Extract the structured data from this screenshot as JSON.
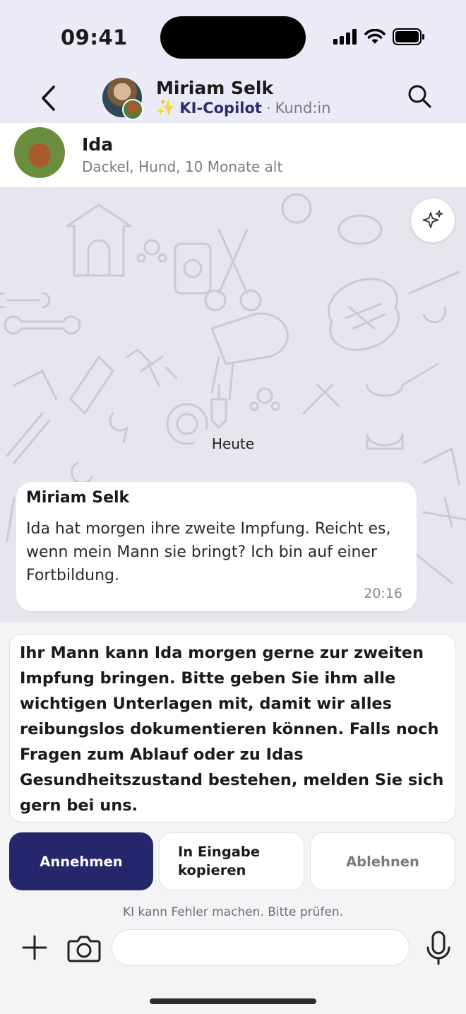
{
  "status_bar": {
    "time": "09:41"
  },
  "header": {
    "name": "Miriam Selk",
    "sparkle": "✨",
    "copilot": "KI-Copilot",
    "separator": "·",
    "role": "Kund:in"
  },
  "contact": {
    "pet_name": "Ida",
    "pet_info": "Dackel, Hund, 10 Monate alt"
  },
  "chat": {
    "day_label": "Heute",
    "message": {
      "sender": "Miriam Selk",
      "text": "Ida hat morgen ihre zweite Impfung. Reicht es, wenn mein Mann sie bringt? Ich bin auf einer Fortbildung.",
      "time": "20:16"
    }
  },
  "suggestion": {
    "text": "Ihr Mann kann Ida morgen gerne zur zweiten Impfung bringen. Bitte geben Sie ihm alle wichtigen Unterlagen mit, damit wir alles reibungslos dokumentieren können. Falls noch Fragen zum Ablauf oder zu Idas Gesundheitszustand bestehen, melden Sie sich gern bei uns."
  },
  "actions": {
    "accept": "Annehmen",
    "copy_line1": "In Eingabe",
    "copy_line2": "kopieren",
    "reject": "Ablehnen"
  },
  "disclaimer": "KI kann Fehler machen. Bitte prüfen.",
  "composer": {
    "value": "",
    "placeholder": ""
  },
  "colors": {
    "accent": "#25266b",
    "copilot_text": "#2b2d6e",
    "header_bg": "#ebebf7"
  }
}
